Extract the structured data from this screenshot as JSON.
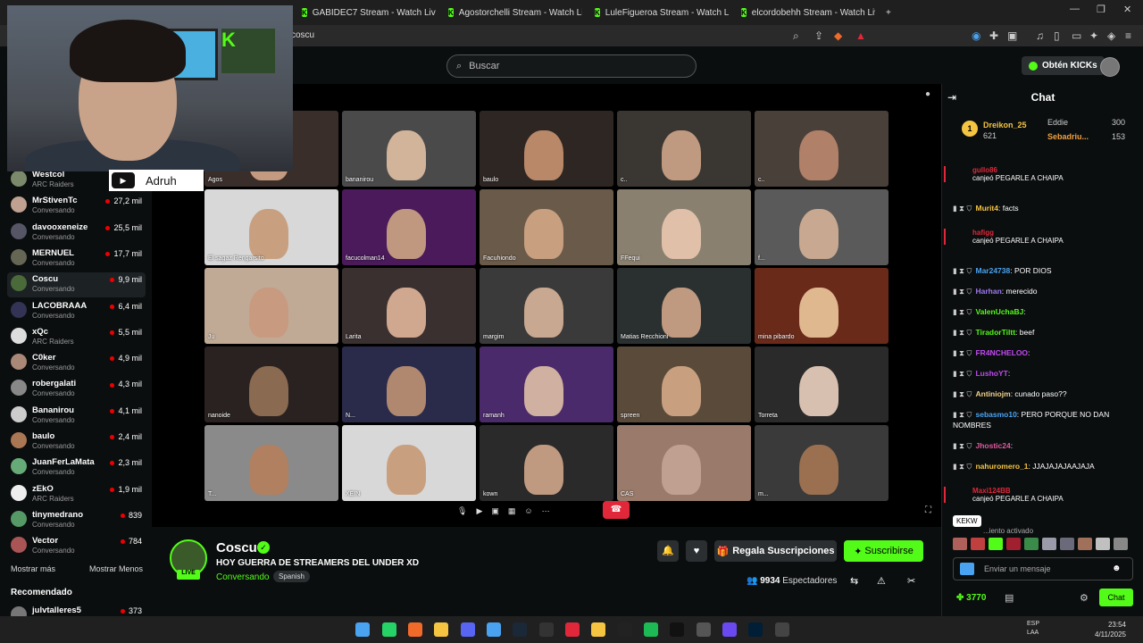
{
  "browser": {
    "tabs": [
      {
        "label": "GABIDEC7 Stream - Watch Live on Ki"
      },
      {
        "label": "Agostorchelli Stream - Watch Live on"
      },
      {
        "label": "LuleFigueroa Stream - Watch Live on"
      },
      {
        "label": "elcordobehh Stream - Watch Live on"
      }
    ],
    "url": "coscu"
  },
  "header": {
    "search_placeholder": "Buscar",
    "kicks_label": "Obtén KICKs"
  },
  "overlay": {
    "label": "Adruh"
  },
  "sidebar": {
    "items": [
      {
        "name": "Westcol",
        "sub": "ARC Raiders",
        "viewers": "",
        "color": "#7a8a6a"
      },
      {
        "name": "MrStivenTc",
        "sub": "Conversando",
        "viewers": "27,2 mil",
        "color": "#c0a090"
      },
      {
        "name": "davooxeneize",
        "sub": "Conversando",
        "viewers": "25,5 mil",
        "color": "#556"
      },
      {
        "name": "MERNUEL",
        "sub": "Conversando",
        "viewers": "17,7 mil",
        "color": "#665"
      },
      {
        "name": "Coscu",
        "sub": "Conversando",
        "viewers": "9,9 mil",
        "color": "#4a6a3a"
      },
      {
        "name": "LACOBRAAA",
        "sub": "Conversando",
        "viewers": "6,4 mil",
        "color": "#335"
      },
      {
        "name": "xQc",
        "sub": "ARC Raiders",
        "viewers": "5,5 mil",
        "color": "#ddd"
      },
      {
        "name": "C0ker",
        "sub": "Conversando",
        "viewers": "4,9 mil",
        "color": "#a87"
      },
      {
        "name": "robergalati",
        "sub": "Conversando",
        "viewers": "4,3 mil",
        "color": "#888"
      },
      {
        "name": "Bananirou",
        "sub": "Conversando",
        "viewers": "4,1 mil",
        "color": "#ccc"
      },
      {
        "name": "baulo",
        "sub": "Conversando",
        "viewers": "2,4 mil",
        "color": "#a75"
      },
      {
        "name": "JuanFerLaMata",
        "sub": "Conversando",
        "viewers": "2,3 mil",
        "color": "#6a7"
      },
      {
        "name": "zEkO",
        "sub": "ARC Raiders",
        "viewers": "1,9 mil",
        "color": "#eee"
      },
      {
        "name": "tinymedrano",
        "sub": "Conversando",
        "viewers": "839",
        "color": "#596"
      },
      {
        "name": "Vector",
        "sub": "Conversando",
        "viewers": "784",
        "color": "#a55"
      }
    ],
    "more_label": "Mostrar más",
    "less_label": "Mostrar Menos",
    "recommended_label": "Recomendado",
    "recommended_first": {
      "name": "julvtalleres5",
      "viewers": "373"
    }
  },
  "stream": {
    "tiles": [
      {
        "name": "Agos",
        "color": "#3a2e2a",
        "skin": "#c49a80"
      },
      {
        "name": "bananirou",
        "color": "#4a4a4a",
        "skin": "#d2b49a"
      },
      {
        "name": "baulo",
        "color": "#2e2622",
        "skin": "#b88868"
      },
      {
        "name": "c..",
        "color": "#3a3632",
        "skin": "#c09a80"
      },
      {
        "name": "c..",
        "color": "#4a403a",
        "skin": "#b08068"
      },
      {
        "name": "El sagaz Rengarsito",
        "color": "#d8d8d8",
        "skin": "#c8a080"
      },
      {
        "name": "facucolman14",
        "color": "#4a1a5a",
        "skin": "#c09880"
      },
      {
        "name": "Facuhiondo",
        "color": "#6a5a4a",
        "skin": "#c8a080"
      },
      {
        "name": "FFequi",
        "color": "#8a8070",
        "skin": "#e0c0a8"
      },
      {
        "name": "f...",
        "color": "#5a5a5a",
        "skin": "#c8a890"
      },
      {
        "name": "Ju",
        "color": "#c0aa96",
        "skin": "#c89a80"
      },
      {
        "name": "Larita",
        "color": "#3a3030",
        "skin": "#d0a890"
      },
      {
        "name": "margim",
        "color": "#3a3a3a",
        "skin": "#c8a890"
      },
      {
        "name": "Matias Recchioni",
        "color": "#2a3030",
        "skin": "#c09a80"
      },
      {
        "name": "mina pibardo",
        "color": "#6a2a1a",
        "skin": "#e0b890"
      },
      {
        "name": "nanoide",
        "color": "#2a2220",
        "skin": "#8a6a50"
      },
      {
        "name": "N...",
        "color": "#2a2a4a",
        "skin": "#b08870"
      },
      {
        "name": "ramanh",
        "color": "#4a2a6a",
        "skin": "#d0b0a0"
      },
      {
        "name": "spreen",
        "color": "#5a4a3a",
        "skin": "#c8a080"
      },
      {
        "name": "Torreta",
        "color": "#2a2a2a",
        "skin": "#d8c0b0"
      },
      {
        "name": "T...",
        "color": "#8a8a8a",
        "skin": "#b08060"
      },
      {
        "name": "XEIN",
        "color": "#d8d8d8",
        "skin": "#c8a080"
      },
      {
        "name": "kown",
        "color": "#2a2a2a",
        "skin": "#c09a80"
      },
      {
        "name": "CAS",
        "color": "#9a7a6a",
        "skin": "#c0a090"
      },
      {
        "name": "m...",
        "color": "#3a3a3a",
        "skin": "#9a7050"
      }
    ]
  },
  "channel": {
    "name": "Coscu",
    "live_label": "LIVE",
    "title": "HOY GUERRA DE STREAMERS DEL UNDER XD",
    "category": "Conversando",
    "language": "Spanish",
    "gift_label": "Regala Suscripciones",
    "subscribe_label": "Suscribirse",
    "viewers_count": "9934",
    "viewers_label": "Espectadores"
  },
  "chat": {
    "title": "Chat",
    "leaderboard": [
      {
        "rank": "1",
        "name": "Dreikon_25",
        "points": "621"
      },
      {
        "name": "Eddie",
        "points": "300"
      },
      {
        "name": "Sebadriu...",
        "points": "153"
      }
    ],
    "messages": [
      {
        "type": "redeem",
        "user": "gullo86",
        "text": "canjeó PEGARLE A CHAIPA"
      },
      {
        "type": "msg",
        "user": "Murit4",
        "text": "facts",
        "color": "#f5c542"
      },
      {
        "type": "redeem",
        "user": "hafigg",
        "text": "canjeó PEGARLE A CHAIPA"
      },
      {
        "type": "msg",
        "user": "Mar24738",
        "text": "POR DIOS",
        "color": "#4aa3f0"
      },
      {
        "type": "msg",
        "user": "Harhan",
        "text": "merecido",
        "color": "#a07af0"
      },
      {
        "type": "msg",
        "user": "ValenUchaBJ",
        "text": "",
        "color": "#53fc18"
      },
      {
        "type": "msg",
        "user": "TiradorTiltt",
        "text": "beef",
        "color": "#53fc18"
      },
      {
        "type": "msg",
        "user": "FR4NCHELOO",
        "text": "",
        "color": "#c04af0"
      },
      {
        "type": "msg",
        "user": "LushoYT",
        "text": "",
        "color": "#c04af0"
      },
      {
        "type": "msg",
        "user": "Antiniojm",
        "text": "cunado paso??",
        "color": "#f0d08a"
      },
      {
        "type": "msg",
        "user": "sebasmo10",
        "text": "PERO PORQUE NO DAN NOMBRES",
        "color": "#4aa3f0"
      },
      {
        "type": "msg",
        "user": "Jhostic24",
        "text": "",
        "color": "#e05aa0"
      },
      {
        "type": "msg",
        "user": "nahuromero_1",
        "text": "JJAJAJAJAAJAJA",
        "color": "#f5c542"
      },
      {
        "type": "redeem",
        "user": "Maxi124BB",
        "text": "canjeó PEGARLE A CHAIPA"
      }
    ],
    "tooltip": "KEKW",
    "slowmode": "...iento activado",
    "input_placeholder": "Enviar un mensaje",
    "points": "3770",
    "send_label": "Chat"
  },
  "taskbar": {
    "lang": "ESP",
    "lang2": "LAA",
    "time": "23:54",
    "date": "4/11/2025"
  }
}
